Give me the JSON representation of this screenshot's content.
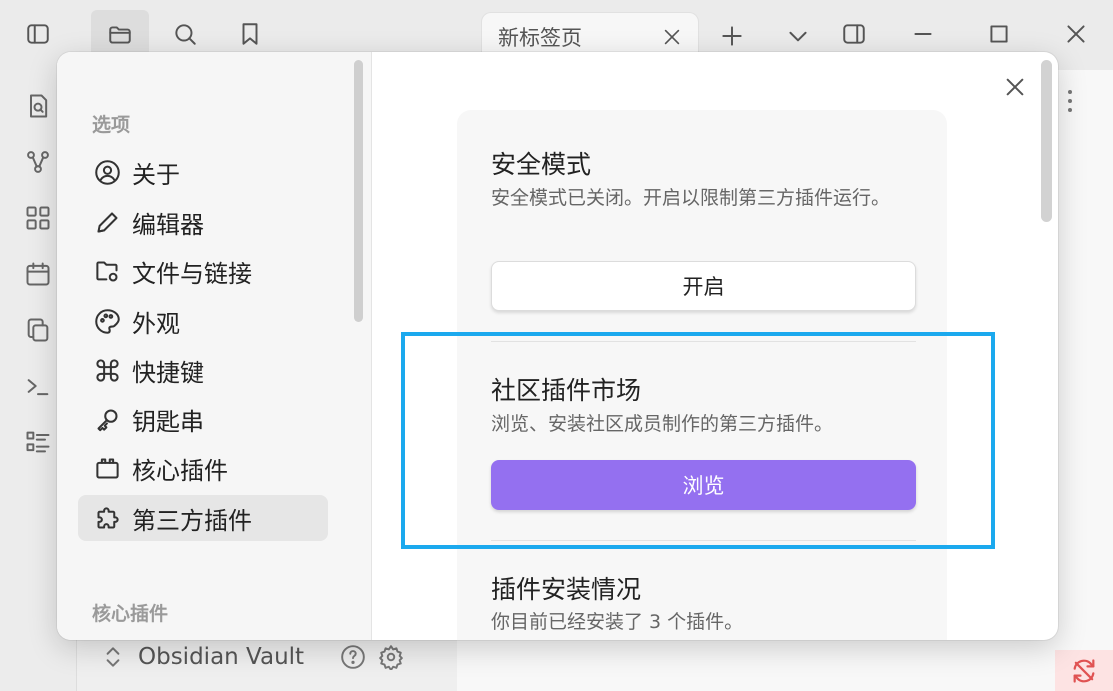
{
  "titlebar": {
    "tab_title": "新标签页"
  },
  "modal": {
    "sidebar": {
      "section_options": "选项",
      "items": [
        {
          "label": "关于",
          "icon": "user-circle-icon"
        },
        {
          "label": "编辑器",
          "icon": "pencil-icon"
        },
        {
          "label": "文件与链接",
          "icon": "folder-cog-icon"
        },
        {
          "label": "外观",
          "icon": "palette-icon"
        },
        {
          "label": "快捷键",
          "icon": "command-icon"
        },
        {
          "label": "钥匙串",
          "icon": "key-icon"
        },
        {
          "label": "核心插件",
          "icon": "plugin-box-icon"
        },
        {
          "label": "第三方插件",
          "icon": "puzzle-icon",
          "active": true
        }
      ],
      "section_core": "核心插件"
    },
    "settings": {
      "safe_mode": {
        "title": "安全模式",
        "desc": "安全模式已关闭。开启以限制第三方插件运行。",
        "button": "开启"
      },
      "community": {
        "title": "社区插件市场",
        "desc": "浏览、安装社区成员制作的第三方插件。",
        "button": "浏览"
      },
      "installed": {
        "title": "插件安装情况",
        "desc": "你目前已经安装了 3 个插件。"
      }
    }
  },
  "bottom": {
    "vault_name": "Obsidian Vault"
  },
  "colors": {
    "accent": "#9470f0",
    "highlight": "#1ba9ee",
    "sync_error": "#e05252"
  }
}
